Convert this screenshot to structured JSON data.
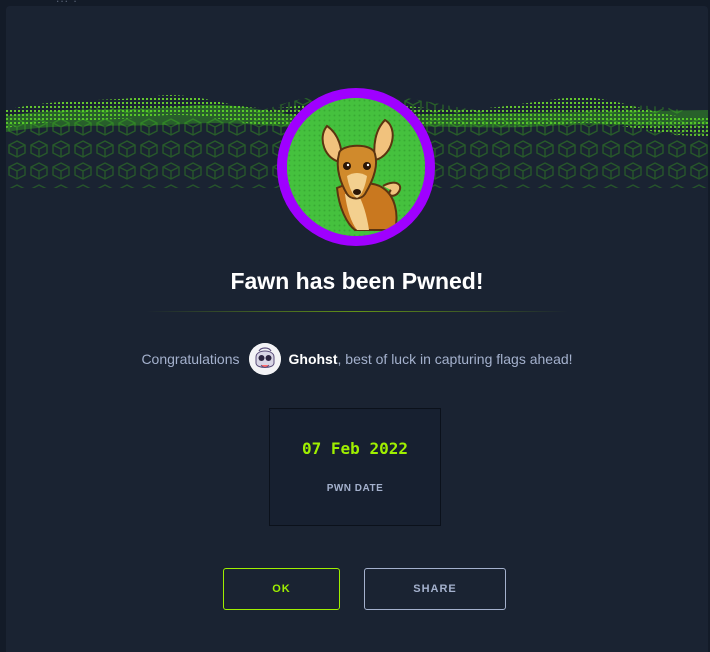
{
  "background": {
    "peek_text": "... ."
  },
  "modal": {
    "title": "Fawn has been Pwned!",
    "congrats": {
      "prefix": "Congratulations",
      "username": "Ghohst",
      "suffix": ", best of luck in capturing flags ahead!"
    },
    "pwn_date": {
      "value": "07 Feb 2022",
      "label": "PWN DATE"
    },
    "buttons": {
      "ok": "OK",
      "share": "SHARE"
    }
  },
  "colors": {
    "accent_green": "#9fef00",
    "avatar_ring": "#9f00ff",
    "panel_bg": "#1a2332",
    "muted_text": "#a4b1cd"
  },
  "icons": {
    "machine_avatar": "fawn-deer-icon",
    "user_avatar": "user-avatar-icon"
  }
}
